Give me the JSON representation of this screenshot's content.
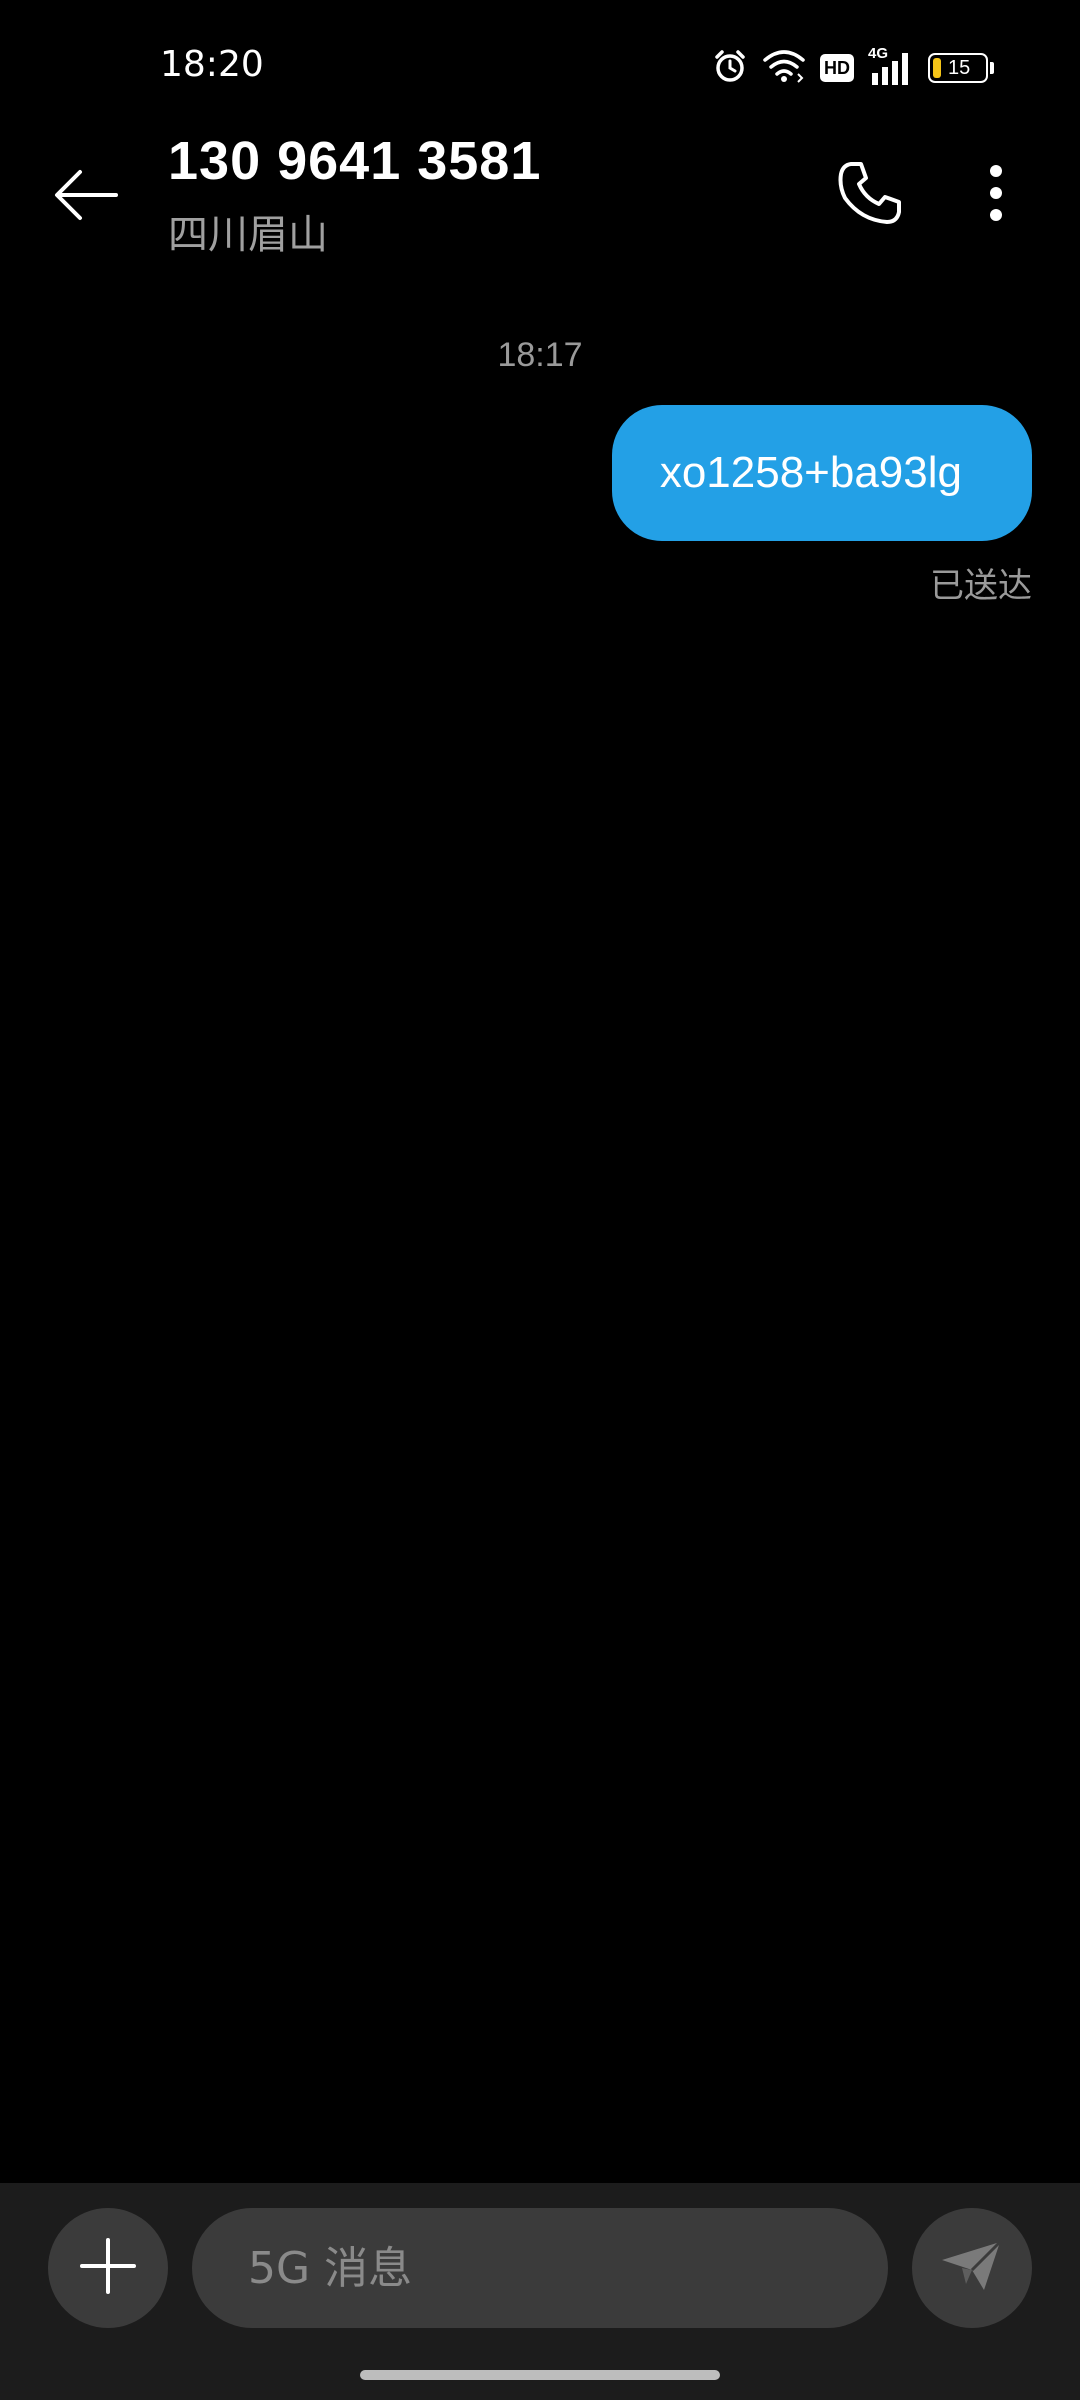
{
  "status_bar": {
    "time": "18:20",
    "hd_label": "HD",
    "network_label": "4G",
    "battery_level": "15",
    "battery_fraction": 0.15,
    "icons": [
      "alarm-icon",
      "wifi-icon",
      "hd-icon",
      "cellular-signal-icon",
      "battery-icon"
    ]
  },
  "header": {
    "contact_number": "130 9641 3581",
    "contact_location": "四川眉山",
    "icons": [
      "back-arrow-icon",
      "phone-icon",
      "more-vertical-icon"
    ]
  },
  "conversation": {
    "messages": [
      {
        "time": "18:17",
        "direction": "outgoing",
        "text": "xo1258+ba93lg",
        "status": "已送达"
      }
    ]
  },
  "compose": {
    "placeholder": "5G 消息",
    "value": "",
    "icons": [
      "plus-icon",
      "send-icon"
    ]
  },
  "colors": {
    "background": "#000000",
    "bubble": "#23a0e6",
    "secondary_text": "#9a9a9a",
    "compose_bar": "#1c1c1c",
    "control": "#3b3b3b",
    "battery_low": "#f5c518"
  }
}
